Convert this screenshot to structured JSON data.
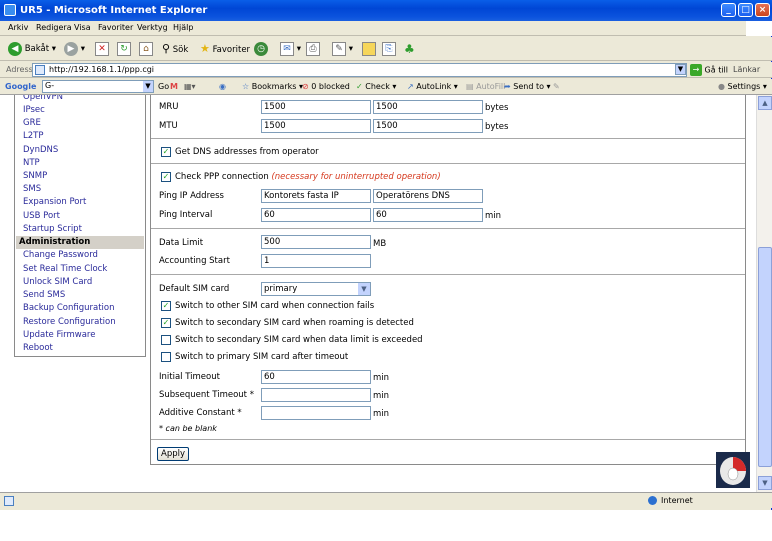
{
  "window": {
    "title": "UR5 - Microsoft Internet Explorer",
    "min": "_",
    "max": "□",
    "close": "×"
  },
  "menubar": [
    "Arkiv",
    "Redigera",
    "Visa",
    "Favoriter",
    "Verktyg",
    "Hjälp"
  ],
  "toolbar": {
    "back": "Bakåt",
    "search": "Sök",
    "favorites": "Favoriter"
  },
  "address": {
    "label": "Adress",
    "url": "http://192.168.1.1/ppp.cgi",
    "go": "Gå till",
    "links": "Länkar"
  },
  "googlebar": {
    "brand": "Google",
    "field": "G-",
    "go": "Go",
    "bookmarks": "Bookmarks",
    "blocked": "0 blocked",
    "check": "Check",
    "autolink": "AutoLink",
    "autofill": "AutoFill",
    "sendto": "Send to",
    "settings": "Settings"
  },
  "sidebar": {
    "items": [
      {
        "label": "OpenVPN"
      },
      {
        "label": "IPsec"
      },
      {
        "label": "GRE"
      },
      {
        "label": "L2TP"
      },
      {
        "label": "DynDNS"
      },
      {
        "label": "NTP"
      },
      {
        "label": "SNMP"
      },
      {
        "label": "SMS"
      },
      {
        "label": "Expansion Port"
      },
      {
        "label": "USB Port"
      },
      {
        "label": "Startup Script"
      }
    ],
    "admin_header": "Administration",
    "admin_items": [
      {
        "label": "Change Password"
      },
      {
        "label": "Set Real Time Clock"
      },
      {
        "label": "Unlock SIM Card"
      },
      {
        "label": "Send SMS"
      },
      {
        "label": "Backup Configuration"
      },
      {
        "label": "Restore Configuration"
      },
      {
        "label": "Update Firmware"
      },
      {
        "label": "Reboot"
      }
    ]
  },
  "form": {
    "mru": {
      "label": "MRU",
      "v1": "1500",
      "v2": "1500",
      "unit": "bytes"
    },
    "mtu": {
      "label": "MTU",
      "v1": "1500",
      "v2": "1500",
      "unit": "bytes"
    },
    "get_dns": {
      "label": "Get DNS addresses from operator",
      "checked": "✓"
    },
    "check_ppp": {
      "label": "Check PPP connection",
      "note": "(necessary for uninterrupted operation)",
      "checked": "✓"
    },
    "ping_ip": {
      "label": "Ping IP Address",
      "v1": "Kontorets fasta IP",
      "v2": "Operatörens DNS"
    },
    "ping_interval": {
      "label": "Ping Interval",
      "v1": "60",
      "v2": "60",
      "unit": "min"
    },
    "data_limit": {
      "label": "Data Limit",
      "value": "500",
      "unit": "MB"
    },
    "accounting_start": {
      "label": "Accounting Start",
      "value": "1"
    },
    "default_sim": {
      "label": "Default SIM card",
      "value": "primary"
    },
    "sw_fail": {
      "label": "Switch to other SIM card when connection fails",
      "checked": "✓"
    },
    "sw_roaming": {
      "label": "Switch to secondary SIM card when roaming is detected",
      "checked": "✓"
    },
    "sw_limit": {
      "label": "Switch to secondary SIM card when data limit is exceeded",
      "checked": ""
    },
    "sw_timeout": {
      "label": "Switch to primary SIM card after timeout",
      "checked": ""
    },
    "initial_timeout": {
      "label": "Initial Timeout",
      "value": "60",
      "unit": "min"
    },
    "subsequent_timeout": {
      "label": "Subsequent Timeout *",
      "value": "",
      "unit": "min"
    },
    "additive_constant": {
      "label": "Additive Constant *",
      "value": "",
      "unit": "min"
    },
    "blank_note": "* can be blank",
    "apply": "Apply"
  },
  "statusbar": {
    "zone": "Internet"
  }
}
